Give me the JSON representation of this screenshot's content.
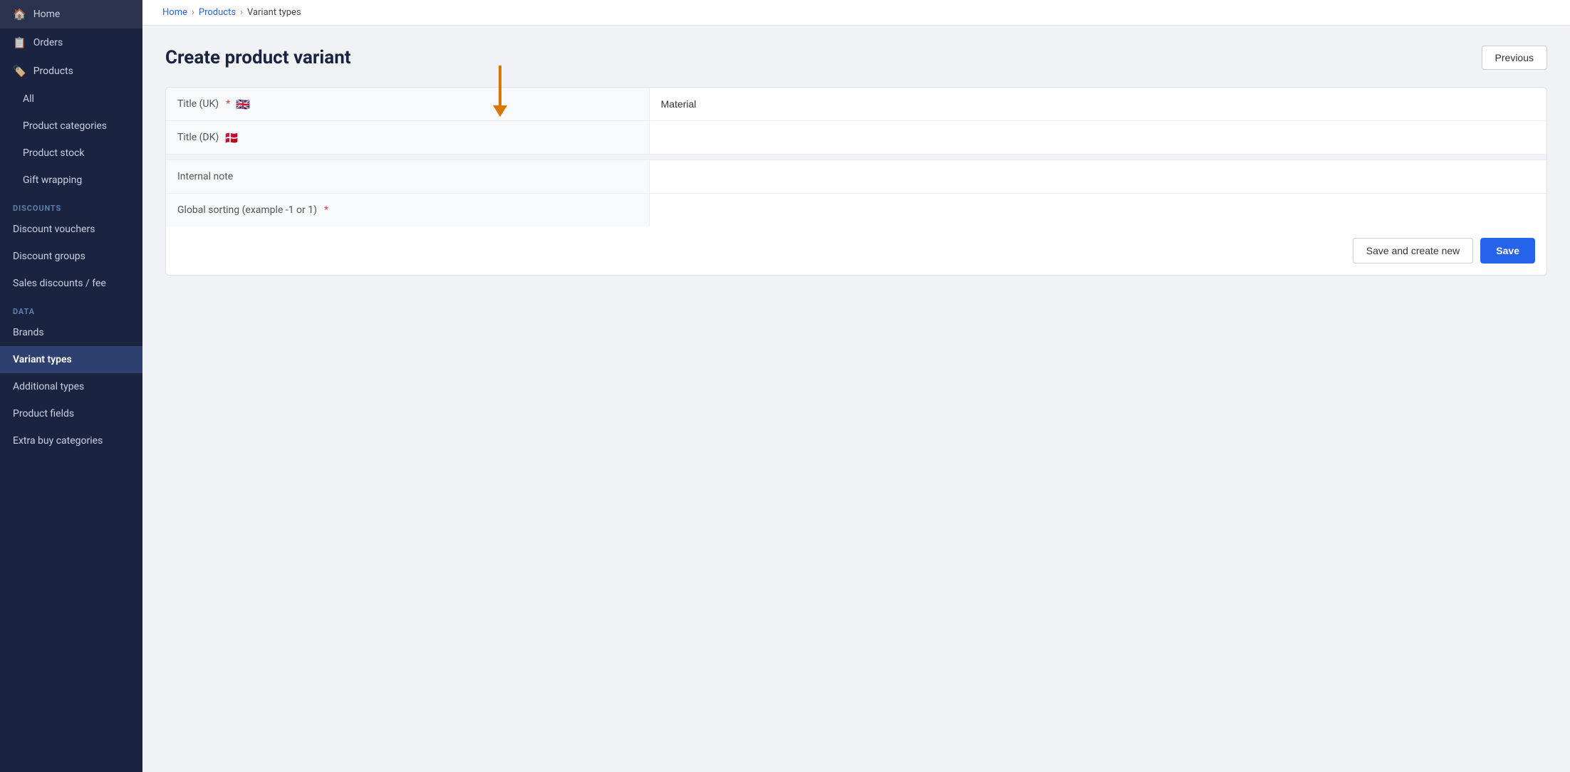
{
  "sidebar": {
    "logo": {
      "label": "Home",
      "icon": "🏠"
    },
    "items": [
      {
        "id": "home",
        "label": "Home",
        "icon": "🏠",
        "active": false
      },
      {
        "id": "orders",
        "label": "Orders",
        "icon": "📋",
        "active": false
      },
      {
        "id": "products",
        "label": "Products",
        "icon": "🏷️",
        "active": false
      }
    ],
    "products_sub": [
      {
        "id": "all",
        "label": "All",
        "active": false
      },
      {
        "id": "product-categories",
        "label": "Product categories",
        "active": false
      },
      {
        "id": "product-stock",
        "label": "Product stock",
        "active": false
      },
      {
        "id": "gift-wrapping",
        "label": "Gift wrapping",
        "active": false
      }
    ],
    "sections": [
      {
        "label": "DISCOUNTS",
        "items": [
          {
            "id": "discount-vouchers",
            "label": "Discount vouchers",
            "active": false
          },
          {
            "id": "discount-groups",
            "label": "Discount groups",
            "active": false
          },
          {
            "id": "sales-discounts",
            "label": "Sales discounts / fee",
            "active": false
          }
        ]
      },
      {
        "label": "DATA",
        "items": [
          {
            "id": "brands",
            "label": "Brands",
            "active": false
          },
          {
            "id": "variant-types",
            "label": "Variant types",
            "active": true
          },
          {
            "id": "additional-types",
            "label": "Additional types",
            "active": false
          },
          {
            "id": "product-fields",
            "label": "Product fields",
            "active": false
          },
          {
            "id": "extra-buy-categories",
            "label": "Extra buy categories",
            "active": false
          }
        ]
      }
    ]
  },
  "breadcrumb": {
    "home": "Home",
    "products": "Products",
    "current": "Variant types"
  },
  "page": {
    "title": "Create product variant",
    "previous_label": "Previous"
  },
  "form": {
    "fields": [
      {
        "label": "Title (UK)",
        "required": true,
        "flag": "🇬🇧",
        "value": "Material",
        "placeholder": ""
      },
      {
        "label": "Title (DK)",
        "required": false,
        "flag": "🇩🇰",
        "value": "",
        "placeholder": ""
      }
    ],
    "fields2": [
      {
        "label": "Internal note",
        "required": false,
        "value": "",
        "placeholder": ""
      },
      {
        "label": "Global sorting (example -1 or 1)",
        "required": true,
        "value": "",
        "placeholder": ""
      }
    ],
    "save_create_label": "Save and create new",
    "save_label": "Save"
  }
}
